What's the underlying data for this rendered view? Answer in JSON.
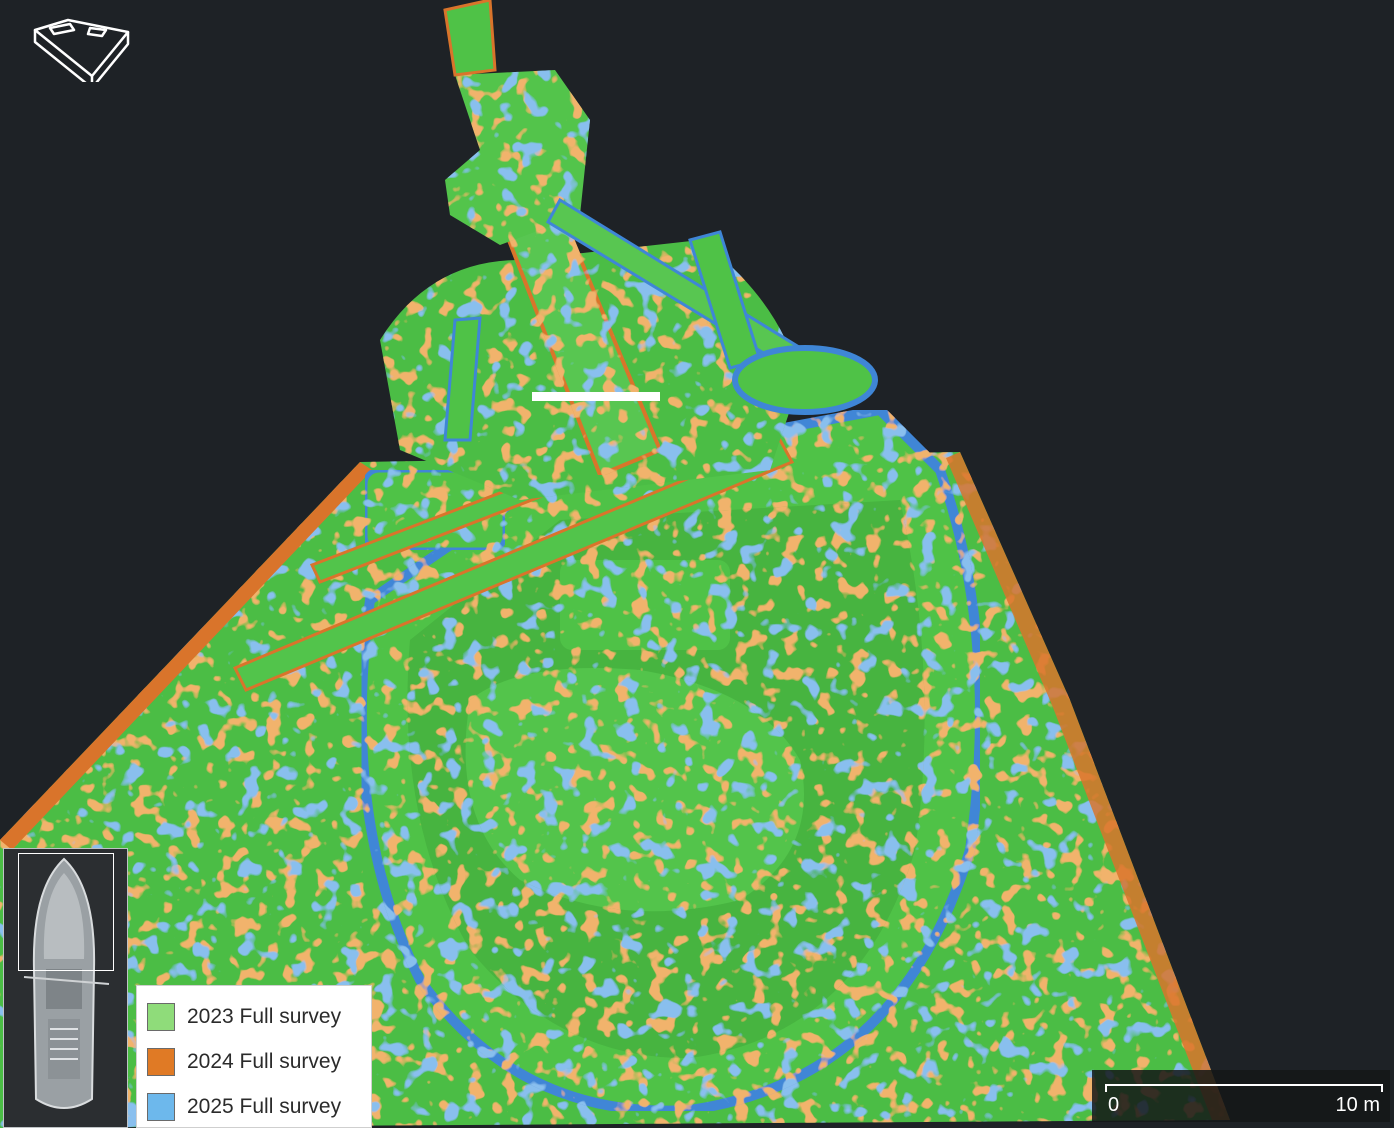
{
  "viewer": {
    "background": "#1e2226",
    "nav_cube_icon": "nav-cube-icon",
    "minimap_icon": "ship-top-view-icon"
  },
  "legend": {
    "items": [
      {
        "label": "2023 Full survey",
        "color": "#8fdc7a"
      },
      {
        "label": "2024 Full survey",
        "color": "#e07a25"
      },
      {
        "label": "2025 Full survey",
        "color": "#6db8ec"
      }
    ]
  },
  "point_cloud_colors": {
    "2023": "#4fc247",
    "2024": "#d9742b",
    "2025": "#3f86d6",
    "outline": "#1f3a1c"
  },
  "scale_bar": {
    "min_label": "0",
    "max_label": "10 m"
  }
}
